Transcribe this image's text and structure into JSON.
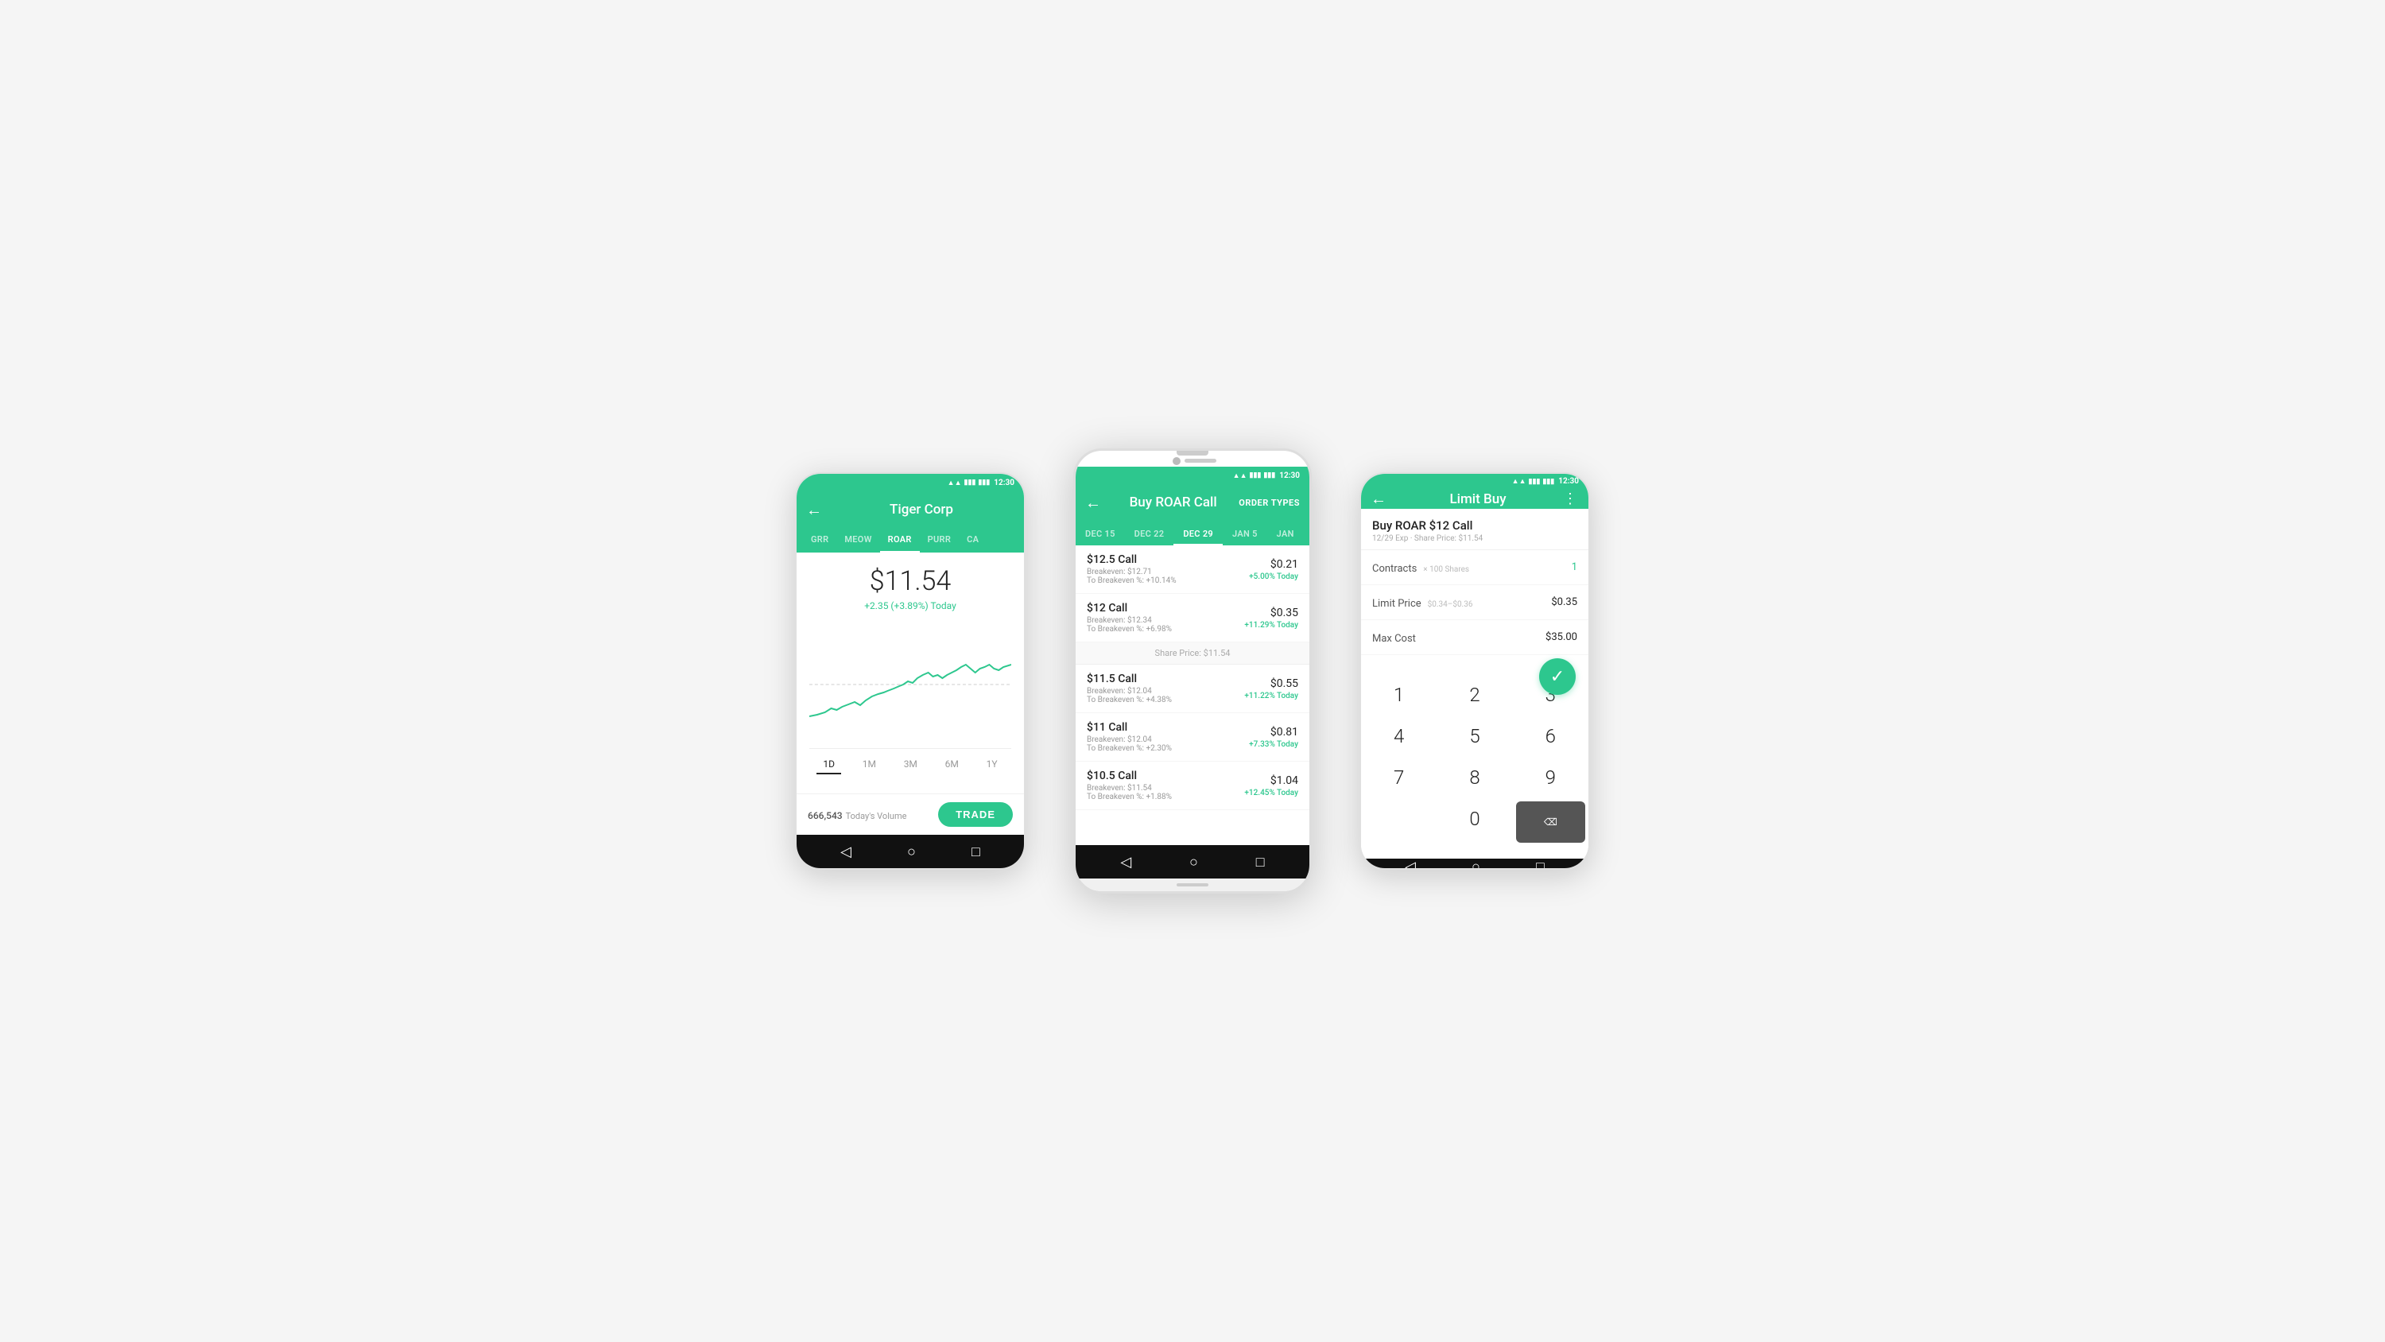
{
  "phone1": {
    "statusBar": {
      "time": "12:30"
    },
    "appBar": {
      "title": "Tiger Corp",
      "backLabel": "←"
    },
    "tabs": [
      {
        "label": "GRR",
        "active": false
      },
      {
        "label": "MEOW",
        "active": false
      },
      {
        "label": "ROAR",
        "active": true
      },
      {
        "label": "PURR",
        "active": false
      },
      {
        "label": "CA",
        "active": false
      }
    ],
    "price": "$11.54",
    "change": "+2.35 (+3.89%) Today",
    "timeTabs": [
      {
        "label": "1D",
        "active": true
      },
      {
        "label": "1M",
        "active": false
      },
      {
        "label": "3M",
        "active": false
      },
      {
        "label": "6M",
        "active": false
      },
      {
        "label": "1Y",
        "active": false
      }
    ],
    "volume": "666,543",
    "volumeLabel": "Today's Volume",
    "tradeBtn": "TRADE"
  },
  "phone2": {
    "statusBar": {
      "time": "12:30"
    },
    "appBar": {
      "title": "Buy ROAR Call",
      "backLabel": "←",
      "rightLabel": "ORDER TYPES"
    },
    "dateTabs": [
      {
        "label": "DEC 15",
        "active": false
      },
      {
        "label": "DEC 22",
        "active": false
      },
      {
        "label": "DEC 29",
        "active": true
      },
      {
        "label": "JAN 5",
        "active": false
      },
      {
        "label": "JAN",
        "active": false
      }
    ],
    "options": [
      {
        "name": "$12.5 Call",
        "breakeven": "Breakeven: $12.71",
        "toBreakeven": "To Breakeven %: +10.14%",
        "price": "$0.21",
        "change": "+5.00% Today"
      },
      {
        "name": "$12 Call",
        "breakeven": "Breakeven: $12.34",
        "toBreakeven": "To Breakeven %: +6.98%",
        "price": "$0.35",
        "change": "+11.29% Today"
      }
    ],
    "sharePriceDivider": "Share Price: $11.54",
    "optionsBelow": [
      {
        "name": "$11.5 Call",
        "breakeven": "Breakeven: $12.04",
        "toBreakeven": "To Breakeven %: +4.38%",
        "price": "$0.55",
        "change": "+11.22% Today"
      },
      {
        "name": "$11 Call",
        "breakeven": "Breakeven: $12.04",
        "toBreakeven": "To Breakeven %: +2.30%",
        "price": "$0.81",
        "change": "+7.33% Today"
      },
      {
        "name": "$10.5 Call",
        "breakeven": "Breakeven: $11.54",
        "toBreakeven": "To Breakeven %: +1.88%",
        "price": "$1.04",
        "change": "+12.45% Today"
      }
    ]
  },
  "phone3": {
    "statusBar": {
      "time": "12:30"
    },
    "appBar": {
      "title": "Limit Buy",
      "backLabel": "←"
    },
    "orderTitle": "Buy ROAR $12 Call",
    "orderSubtitle": "12/29 Exp · Share Price: $11.54",
    "rows": [
      {
        "label": "Contracts",
        "hint": "× 100 Shares",
        "value": "1"
      },
      {
        "label": "Limit Price",
        "hint": "$0.34–$0.36",
        "value": "$0.35"
      },
      {
        "label": "Max Cost",
        "hint": "",
        "value": "$35.00"
      }
    ],
    "keypad": [
      "1",
      "2",
      "3",
      "4",
      "5",
      "6",
      "7",
      "8",
      "9",
      "0",
      "⌫"
    ],
    "confirmCheck": "✓"
  }
}
